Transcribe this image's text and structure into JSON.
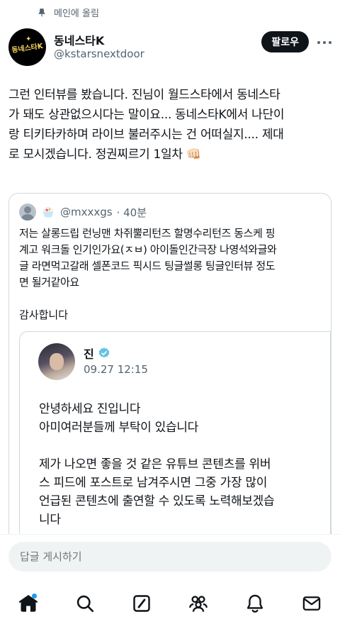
{
  "pinned": {
    "label": "메인에 올림"
  },
  "author": {
    "name": "동네스타K",
    "handle": "@kstarsnextdoor",
    "avatar_text": "동네스타K",
    "follow_label": "팔로우"
  },
  "post": {
    "text": "그런 인터뷰를 봤습니다. 진님이 월드스타에서 동네스타\n가 돼도 상관없으시다는 말이요... 동네스타K에서 나단이\n랑 티키타카하며 라이브 불러주시는 건 어떠실지.... 제대\n로 모시겠습니다. 정권찌르기 1일차 👊🏻"
  },
  "quote": {
    "handle": "@mxxxgs",
    "time": "· 40분",
    "text": "저는 살롱드립 런닝맨 차쥐뿔리턴즈 할명수리턴즈 동스케 핑\n계고 워크돌 인기인가요(ㅈㅂ) 아이돌인간극장 나영석와글와\n글 라면먹고갈래 셀폰코드 픽시드 팅글썰롱 팅글인터뷰 정도\n면 될거같아요",
    "thanks": "감사합니다",
    "inner": {
      "name": "진",
      "time": "09.27 12:15",
      "text": "안녕하세요 진입니다\n아미여러분들께 부탁이 있습니다\n\n제가 나오면 좋을 것 같은 유튜브 콘텐츠를 위버\n스 피드에 포스트로 남겨주시면 그중 가장 많이\n언급된 콘텐츠에 출연할 수 있도록 노력해보겠습\n니다"
    }
  },
  "reply": {
    "placeholder": "답글 게시하기"
  },
  "nav": [
    "home-icon",
    "search-icon",
    "grok-icon",
    "communities-icon",
    "notifications-icon",
    "messages-icon"
  ],
  "colors": {
    "accent": "#1d9bf0",
    "text": "#0f1419",
    "muted": "#536471",
    "border": "#cfd9de"
  }
}
